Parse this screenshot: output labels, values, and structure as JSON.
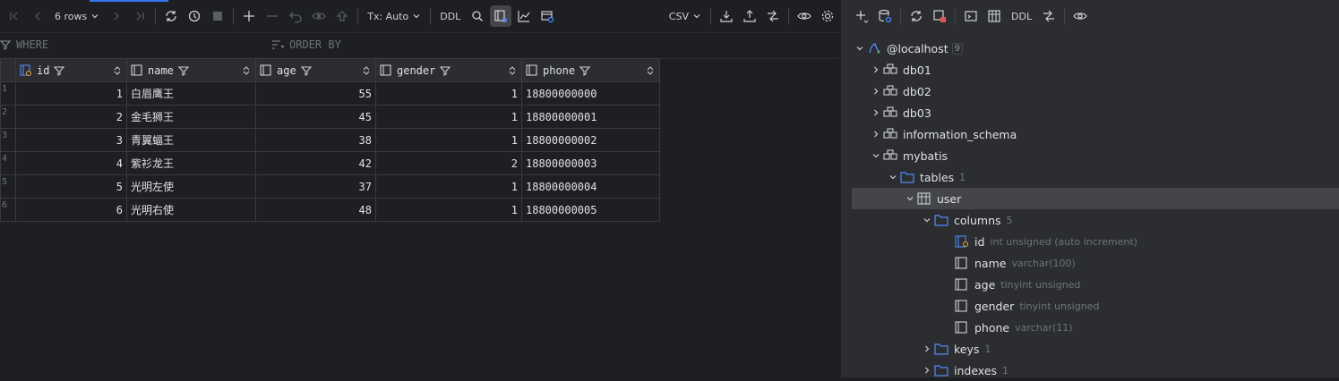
{
  "toolbar": {
    "rows_label": "6 rows",
    "tx_label": "Tx: Auto",
    "ddl_label": "DDL",
    "csv_label": "CSV"
  },
  "filters": {
    "where_placeholder": "WHERE",
    "orderby_placeholder": "ORDER BY"
  },
  "grid": {
    "columns": [
      "id",
      "name",
      "age",
      "gender",
      "phone"
    ],
    "rows": [
      {
        "num": "1",
        "id": "1",
        "name": "白眉鹰王",
        "age": "55",
        "gender": "1",
        "phone": "18800000000"
      },
      {
        "num": "2",
        "id": "2",
        "name": "金毛狮王",
        "age": "45",
        "gender": "1",
        "phone": "18800000001"
      },
      {
        "num": "3",
        "id": "3",
        "name": "青翼蝠王",
        "age": "38",
        "gender": "1",
        "phone": "18800000002"
      },
      {
        "num": "4",
        "id": "4",
        "name": "紫衫龙王",
        "age": "42",
        "gender": "2",
        "phone": "18800000003"
      },
      {
        "num": "5",
        "id": "5",
        "name": "光明左使",
        "age": "37",
        "gender": "1",
        "phone": "18800000004"
      },
      {
        "num": "6",
        "id": "6",
        "name": "光明右使",
        "age": "48",
        "gender": "1",
        "phone": "18800000005"
      }
    ]
  },
  "right_toolbar": {
    "ddl_label": "DDL"
  },
  "tree": {
    "host": {
      "label": "@localhost",
      "count": "9"
    },
    "databases": [
      "db01",
      "db02",
      "db03",
      "information_schema",
      "mybatis"
    ],
    "tables": {
      "label": "tables",
      "count": "1"
    },
    "user": {
      "label": "user"
    },
    "columns": {
      "label": "columns",
      "count": "5"
    },
    "cols": [
      {
        "name": "id",
        "type": "int unsigned (auto increment)"
      },
      {
        "name": "name",
        "type": "varchar(100)"
      },
      {
        "name": "age",
        "type": "tinyint unsigned"
      },
      {
        "name": "gender",
        "type": "tinyint unsigned"
      },
      {
        "name": "phone",
        "type": "varchar(11)"
      }
    ],
    "keys": {
      "label": "keys",
      "count": "1"
    },
    "indexes": {
      "label": "indexes",
      "count": "1"
    }
  },
  "colors": {
    "accent": "#3574f0",
    "key": "#e8a33c",
    "folder": "#548af7"
  }
}
